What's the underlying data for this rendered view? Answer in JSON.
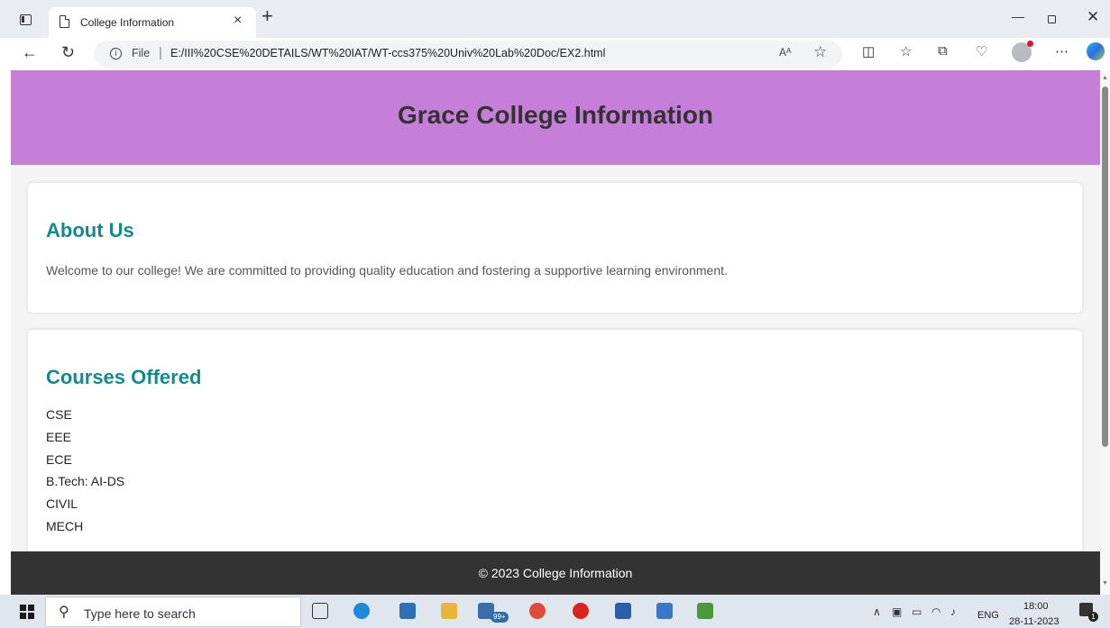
{
  "browser": {
    "tab_title": "College Information",
    "tab_close_glyph": "×",
    "new_tab_glyph": "+",
    "file_label": "File",
    "address_separator": "|",
    "url": "E:/III%20CSE%20DETAILS/WT%20IAT/WT-ccs375%20Univ%20Lab%20Doc/EX2.html",
    "read_aloud_glyph": "Aᴬ",
    "icons": [
      "sidebar-toggle-icon",
      "page-icon",
      "back-icon",
      "refresh-icon",
      "info-icon",
      "read-aloud-icon",
      "favorite-star-icon",
      "split-screen-icon",
      "favorites-icon",
      "collections-icon",
      "browser-essentials-icon",
      "profile-icon",
      "more-icon",
      "copilot-icon"
    ]
  },
  "page": {
    "header_title": "Grace College Information",
    "about": {
      "title": "About Us",
      "text": "Welcome to our college! We are committed to providing quality education and fostering a supportive learning environment."
    },
    "courses": {
      "title": "Courses Offered",
      "items": [
        "CSE",
        "EEE",
        "ECE",
        "B.Tech: AI-DS",
        "CIVIL",
        "MECH"
      ]
    },
    "footer_text": "© 2023 College Information"
  },
  "colors": {
    "header_bg": "#c67fd9",
    "section_title": "#158a8a",
    "footer_bg": "#333333",
    "page_bg": "#f4f4f4"
  },
  "taskbar": {
    "search_placeholder": "Type here to search",
    "mail_badge": "99+",
    "language": "ENG",
    "time": "18:00",
    "date": "28-11-2023",
    "notification_count": "1"
  }
}
